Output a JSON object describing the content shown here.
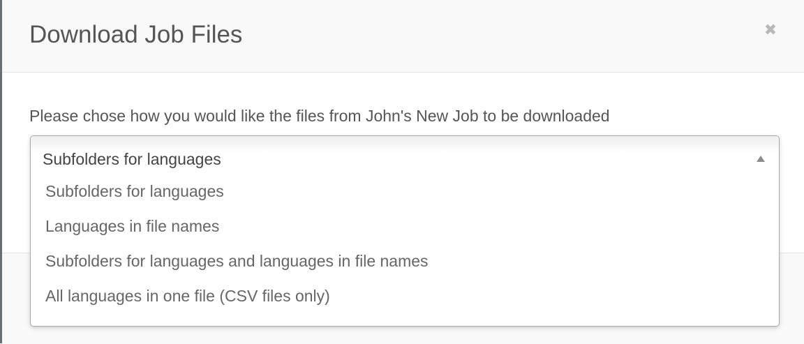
{
  "dialog": {
    "title": "Download Job Files",
    "close_glyph": "✖",
    "close_icon": "close-icon",
    "prompt": "Please chose how you would like the files from John's New Job to be downloaded"
  },
  "select": {
    "selected": "Subfolders for languages",
    "expanded": true,
    "arrow_icon": "arrow-up-icon",
    "options": [
      {
        "label": "Subfolders for languages"
      },
      {
        "label": "Languages in file names"
      },
      {
        "label": "Subfolders for languages and languages in file names"
      },
      {
        "label": "All languages in one file (CSV files only)"
      }
    ]
  }
}
